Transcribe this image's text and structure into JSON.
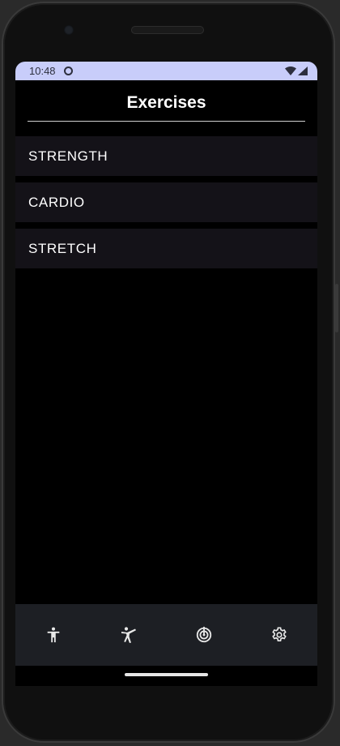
{
  "status_bar": {
    "time": "10:48",
    "icons": [
      "avatar-icon",
      "wifi-icon",
      "cellular-signal-icon"
    ]
  },
  "header": {
    "title": "Exercises"
  },
  "categories": [
    {
      "label": "STRENGTH"
    },
    {
      "label": "CARDIO"
    },
    {
      "label": "STRETCH"
    }
  ],
  "bottom_nav": {
    "items": [
      {
        "icon": "person-standing-icon"
      },
      {
        "icon": "martial-arts-kick-icon"
      },
      {
        "icon": "target-icon"
      },
      {
        "icon": "settings-gear-icon"
      }
    ]
  },
  "colors": {
    "status_bar_bg": "#c8cdfa",
    "screen_bg": "#000000",
    "list_item_bg": "#141218",
    "nav_bg": "#1d1f24",
    "text_primary": "#ffffff"
  }
}
